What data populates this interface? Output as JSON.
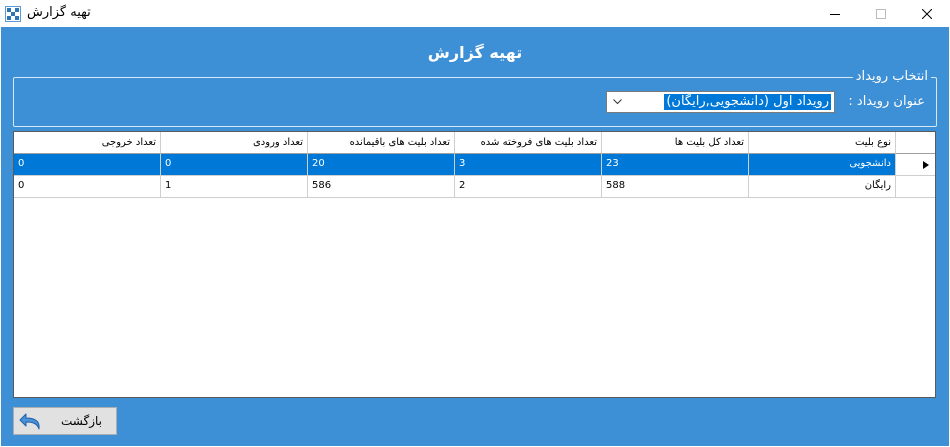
{
  "window": {
    "title": "تهیه گزارش",
    "controls": {
      "minimize": "—",
      "maximize": "☐",
      "close": "✕"
    }
  },
  "form": {
    "heading": "تهیه گزارش",
    "group": {
      "legend": "انتخاب رویداد",
      "event_label": "عنوان رویداد :",
      "event_value": "رویداد اول (دانشجویی,رایگان)"
    }
  },
  "grid": {
    "columns": [
      "نوع بلیت",
      "تعداد کل بلیت ها",
      "تعداد بلیت های فروخته شده",
      "تعداد بلیت های باقیمانده",
      "تعداد ورودی",
      "تعداد خروجی"
    ],
    "rows": [
      {
        "selected": true,
        "cells": [
          "دانشجویی",
          "23",
          "3",
          "20",
          "0",
          "0"
        ]
      },
      {
        "selected": false,
        "cells": [
          "رایگان",
          "588",
          "2",
          "586",
          "1",
          "0"
        ]
      }
    ]
  },
  "footer": {
    "back_label": "بازگشت"
  },
  "colors": {
    "form_background": "#3d8fd6",
    "selection": "#0078d7"
  }
}
